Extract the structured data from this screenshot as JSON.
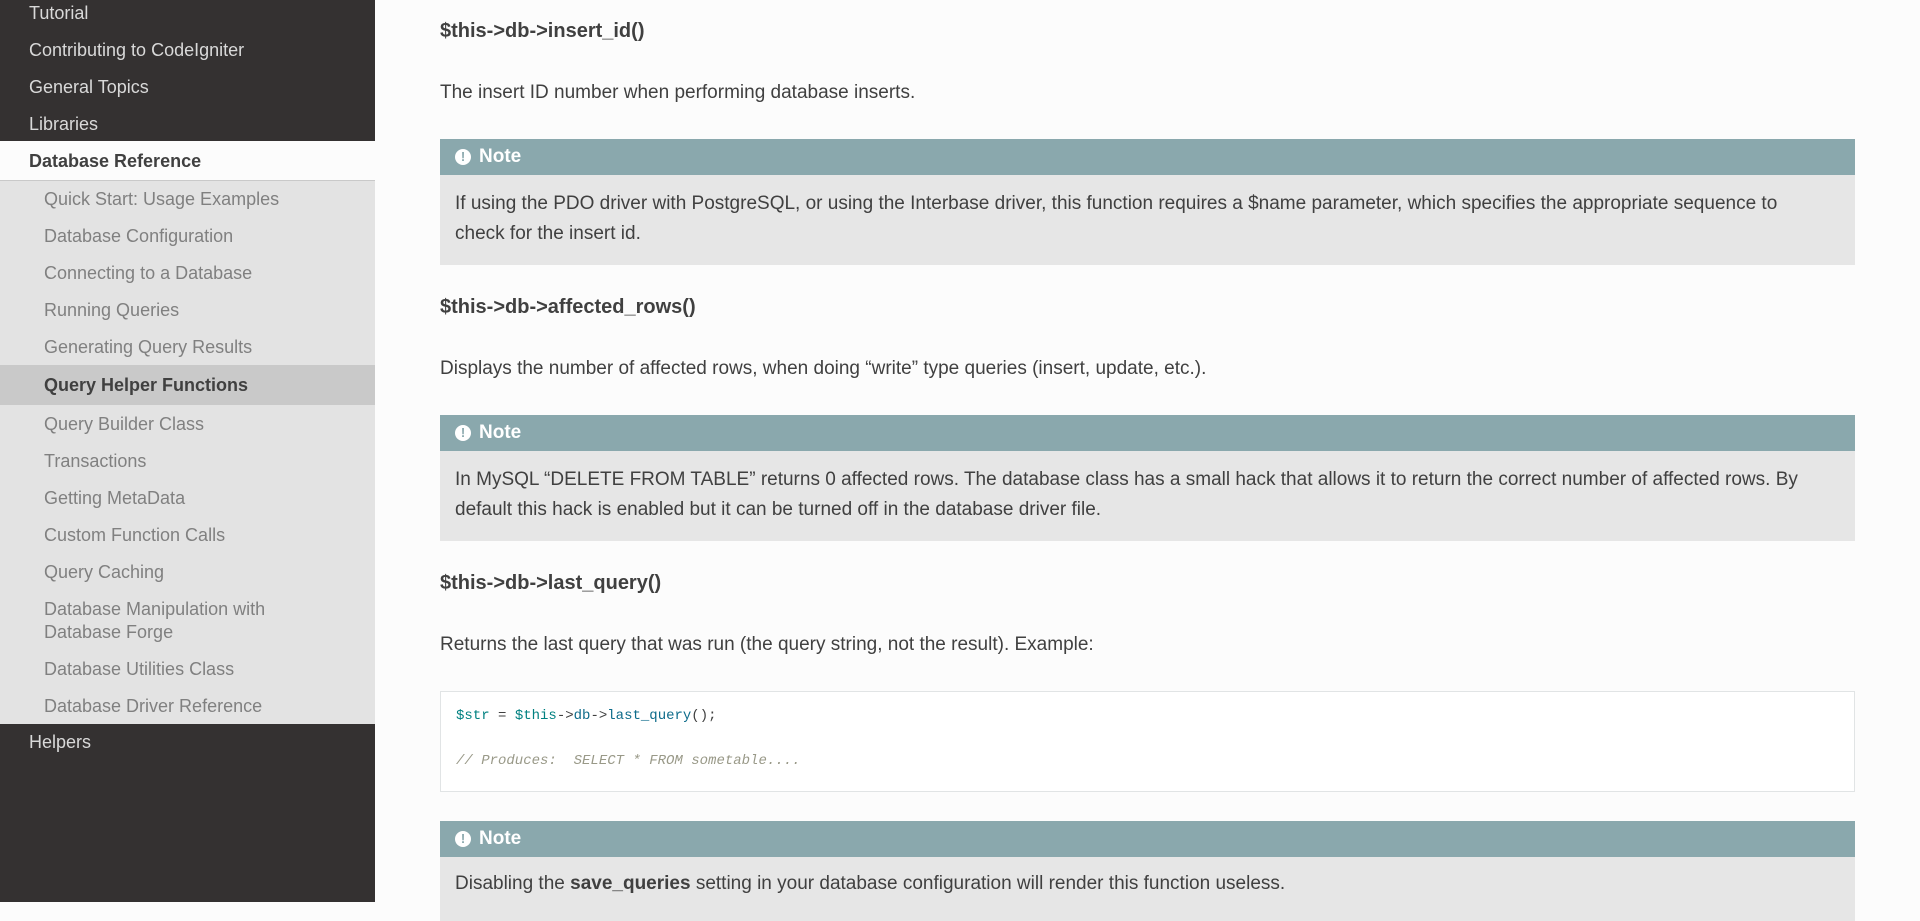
{
  "sidebar": {
    "top_items": [
      "Tutorial",
      "Contributing to CodeIgniter",
      "General Topics",
      "Libraries"
    ],
    "active_section": "Database Reference",
    "sub_items": [
      "Quick Start: Usage Examples",
      "Database Configuration",
      "Connecting to a Database",
      "Running Queries",
      "Generating Query Results",
      "Query Helper Functions",
      "Query Builder Class",
      "Transactions",
      "Getting MetaData",
      "Custom Function Calls",
      "Query Caching",
      "Database Manipulation with",
      "Database Forge",
      "Database Utilities Class",
      "Database Driver Reference"
    ],
    "bottom_item": "Helpers"
  },
  "content": {
    "sections": [
      {
        "heading": "$this->db->insert_id()",
        "text": "The insert ID number when performing database inserts.",
        "note_title": "Note",
        "note_line1": "If using the PDO driver with PostgreSQL, or using the Interbase driver, this function requires a $name parameter, which specifies the appropriate sequence to",
        "note_line2": "check for the insert id."
      },
      {
        "heading": "$this->db->affected_rows()",
        "text": "Displays the number of affected rows, when doing “write” type queries (insert, update, etc.).",
        "note_title": "Note",
        "note_line1": "In MySQL “DELETE FROM TABLE” returns 0 affected rows. The database class has a small hack that allows it to return the correct number of affected rows. By",
        "note_line2": "default this hack is enabled but it can be turned off in the database driver file."
      },
      {
        "heading": "$this->db->last_query()",
        "text": "Returns the last query that was run (the query string, not the result). Example:",
        "code_var": "$str",
        "code_eq": " = ",
        "code_this": "$this",
        "code_arrow1": "->",
        "code_db": "db",
        "code_arrow2": "->",
        "code_fn": "last_query",
        "code_tail": "();",
        "code_comment": "// Produces:  SELECT * FROM sometable....",
        "note_title": "Note",
        "note_pre": "Disabling the ",
        "note_bold": "save_queries",
        "note_post": " setting in your database configuration will render this function useless."
      }
    ]
  }
}
